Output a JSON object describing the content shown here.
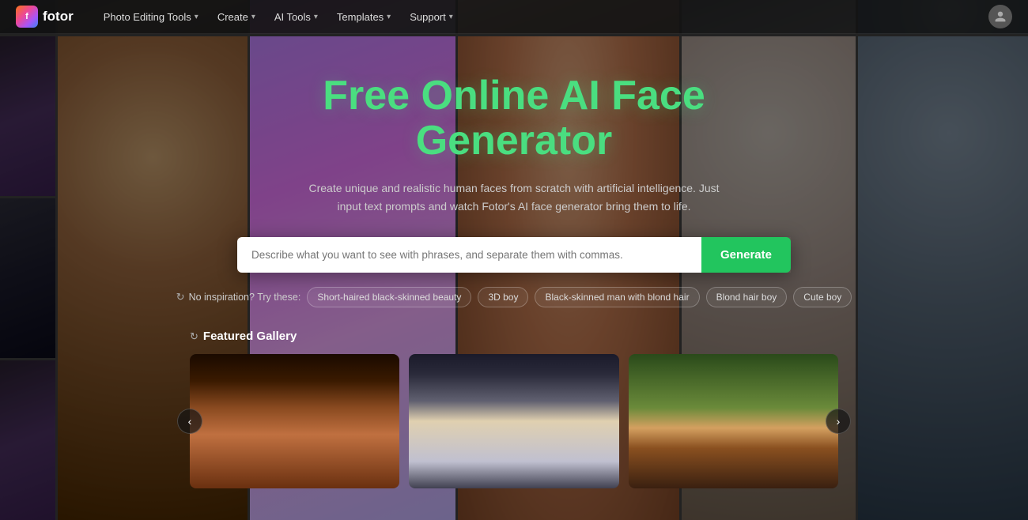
{
  "brand": {
    "logo_text": "fotor",
    "logo_abbr": "f"
  },
  "nav": {
    "items": [
      {
        "id": "photo-editing",
        "label": "Photo Editing Tools",
        "has_dropdown": true
      },
      {
        "id": "create",
        "label": "Create",
        "has_dropdown": true
      },
      {
        "id": "ai-tools",
        "label": "AI Tools",
        "has_dropdown": true
      },
      {
        "id": "templates",
        "label": "Templates",
        "has_dropdown": true
      },
      {
        "id": "support",
        "label": "Support",
        "has_dropdown": true
      }
    ]
  },
  "hero": {
    "title_line1": "Free Online AI Face",
    "title_line2": "Generator",
    "subtitle": "Create unique and realistic human faces from scratch with artificial intelligence. Just input text prompts and watch Fotor's AI face generator bring them to life.",
    "search_placeholder": "Describe what you want to see with phrases, and separate them with commas.",
    "generate_btn": "Generate"
  },
  "suggestions": {
    "label": "No inspiration? Try these:",
    "chips": [
      "Short-haired black-skinned beauty",
      "3D boy",
      "Black-skinned man with blond hair",
      "Blond hair boy",
      "Cute boy"
    ]
  },
  "gallery": {
    "title": "Featured Gallery",
    "nav_left": "‹",
    "nav_right": "›"
  },
  "colors": {
    "accent_green": "#4ade80",
    "btn_green": "#22c55e"
  }
}
